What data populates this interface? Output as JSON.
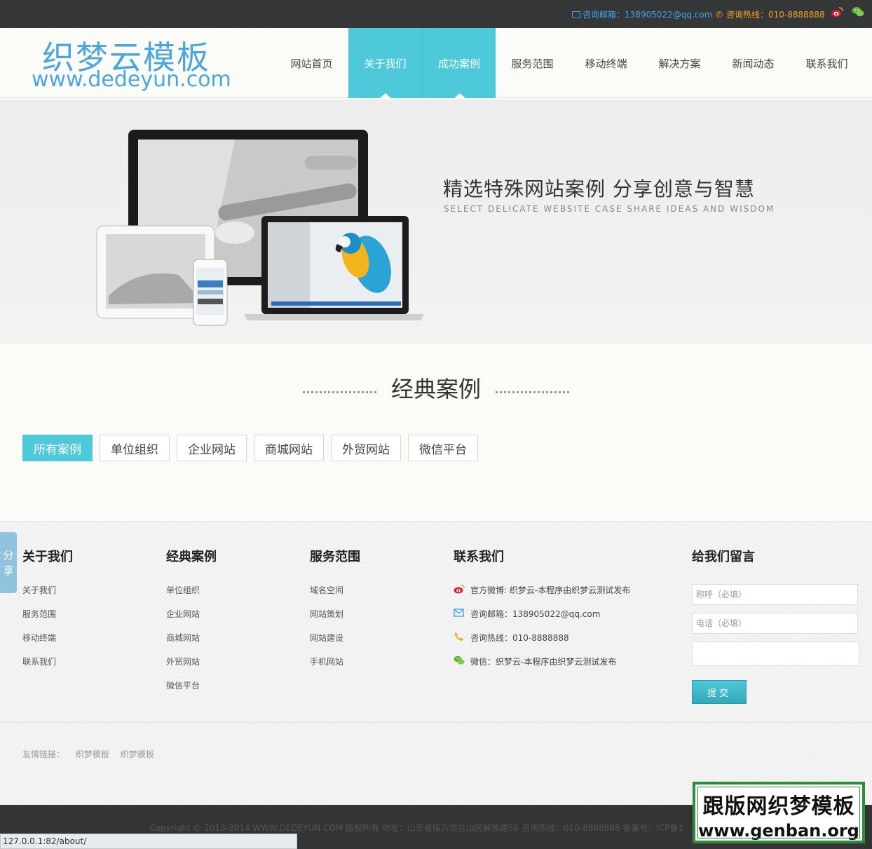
{
  "topbar": {
    "email": "咨询邮箱：138905022@qq.com",
    "hotline": "咨询热线：010-8888888"
  },
  "logo": {
    "cn": "织梦云模板",
    "en": "www.dedeyun.com"
  },
  "nav": [
    {
      "label": "网站首页"
    },
    {
      "label": "关于我们"
    },
    {
      "label": "成功案例"
    },
    {
      "label": "服务范围"
    },
    {
      "label": "移动终端"
    },
    {
      "label": "解决方案"
    },
    {
      "label": "新闻动态"
    },
    {
      "label": "联系我们"
    }
  ],
  "banner": {
    "title": "精选特殊网站案例  分享创意与智慧",
    "subtitle": "SELECT  DELICATE WEBSITE CASE     SHARE IDEAS AND WISDOM"
  },
  "section": {
    "title": "经典案例"
  },
  "filters": [
    "所有案例",
    "单位组织",
    "企业网站",
    "商城网站",
    "外贸网站",
    "微信平台"
  ],
  "share": "分享",
  "footer": {
    "about": {
      "title": "关于我们",
      "links": [
        "关于我们",
        "服务范围",
        "移动终端",
        "联系我们"
      ]
    },
    "cases": {
      "title": "经典案例",
      "links": [
        "单位组织",
        "企业网站",
        "商城网站",
        "外贸网站",
        "微信平台"
      ]
    },
    "services": {
      "title": "服务范围",
      "links": [
        "域名空间",
        "网站策划",
        "网站建设",
        "手机网站"
      ]
    },
    "contact": {
      "title": "联系我们",
      "weibo": "官方微博: 织梦云-本程序由织梦云测试发布",
      "email": "咨询邮箱：138905022@qq.com",
      "hotline": "咨询热线：010-8888888",
      "wechat": "微信：织梦云-本程序由织梦云测试发布"
    },
    "message": {
      "title": "给我们留言",
      "name_placeholder": "称呼（必填）",
      "phone_placeholder": "电话（必填）",
      "submit": "提交"
    },
    "friend_label": "友情链接：",
    "friend_links": [
      "织梦模板",
      "织梦模板"
    ],
    "copyright": "Copyright © 2013-2014 WWW.DEDEYUN.COM 版权所有   地址：山东省临沂市兰山区解放路56   咨询热线：010-8888888   备案号：ICP备1"
  },
  "statusbar": "127.0.0.1:82/about/",
  "watermark": {
    "line1": "跟版网织梦模板",
    "line2": "www.genban.org"
  }
}
